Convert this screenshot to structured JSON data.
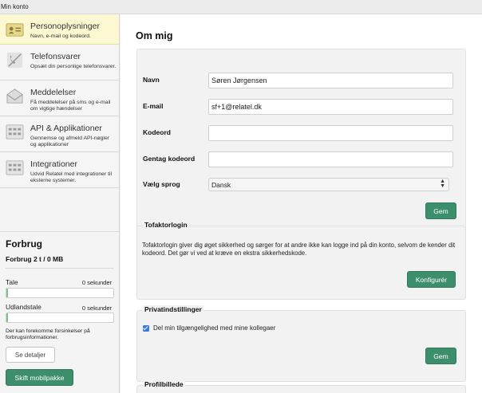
{
  "window": {
    "title": "Min konto"
  },
  "sidebar": {
    "items": [
      {
        "title": "Personoplysninger",
        "subtitle": "Navn, e-mail og kodeord.",
        "icon": "id-card-icon",
        "active": true
      },
      {
        "title": "Telefonsvarer",
        "subtitle": "Opsæt din personlige telefonsvarer.",
        "icon": "phone-off-icon",
        "active": false
      },
      {
        "title": "Meddelelser",
        "subtitle": "Få meddelelser på sms og e-mail om vigtige hændelser",
        "icon": "envelope-icon",
        "active": false
      },
      {
        "title": "API & Applikationer",
        "subtitle": "Gennemse og afmeld API-nøgler og applikationer",
        "icon": "app-grid-icon",
        "active": false
      },
      {
        "title": "Integrationer",
        "subtitle": "Udvid Relatel med integrationer til eksterne systemer.",
        "icon": "integration-grid-icon",
        "active": false
      }
    ]
  },
  "usage": {
    "title": "Forbrug",
    "summary": "Forbrug 2 t / 0 MB",
    "meters": [
      {
        "label": "Tale",
        "value": "0 sekunder",
        "fill": 0.01
      },
      {
        "label": "Udlandstale",
        "value": "0 sekunder",
        "fill": 0.01
      }
    ],
    "note": "Der kan forekomme forsinkelser på forbrugsinformationer.",
    "details_button": "Se detaljer",
    "change_button": "Skift mobilpakke"
  },
  "main": {
    "title": "Om mig",
    "form": {
      "name_label": "Navn",
      "name_value": "Søren Jørgensen",
      "email_label": "E-mail",
      "email_value": "sf+1@relatel.dk",
      "password_label": "Kodeord",
      "password_value": "",
      "password_repeat_label": "Gentag kodeord",
      "password_repeat_value": "",
      "language_label": "Vælg sprog",
      "language_value": "Dansk",
      "save_button": "Gem"
    },
    "two_factor": {
      "title": "Tofaktorlogin",
      "text": "Tofaktorlogin giver dig øget sikkerhed og sørger for at andre ikke kan logge ind på din konto, selvom de kender dit kodeord. Det gør vi ved at kræve en ekstra sikkerhedskode.",
      "configure_button": "Konfigurér"
    },
    "privacy": {
      "title": "Privatindstillinger",
      "checkbox_label": "Del min tilgængelighed med mine kollegaer",
      "checked": true,
      "save_button": "Gem"
    },
    "profile_picture": {
      "title": "Profilbillede"
    }
  },
  "colors": {
    "accent_green": "#3c8e6c",
    "active_nav": "#fcf8d2",
    "checkbox_blue": "#3b7be0"
  }
}
